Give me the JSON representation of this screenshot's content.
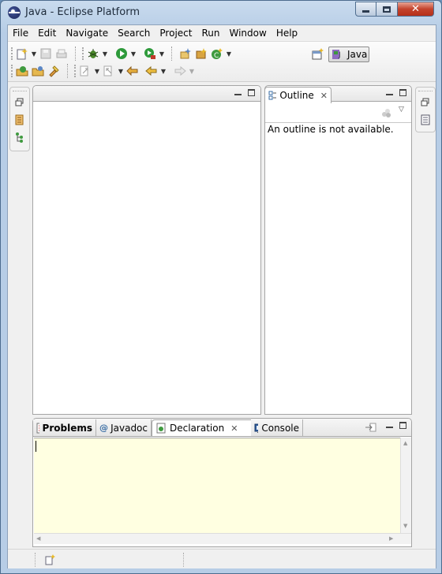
{
  "window": {
    "title": "Java - Eclipse Platform",
    "controls": {
      "minimize": "minimize",
      "maximize": "maximize",
      "close": "close"
    }
  },
  "menubar": {
    "items": [
      {
        "label": "File"
      },
      {
        "label": "Edit"
      },
      {
        "label": "Navigate"
      },
      {
        "label": "Search"
      },
      {
        "label": "Project"
      },
      {
        "label": "Run"
      },
      {
        "label": "Window"
      },
      {
        "label": "Help"
      }
    ]
  },
  "perspectives": {
    "open_perspective": "open-perspective-icon",
    "active": {
      "label": "Java"
    }
  },
  "outline_view": {
    "tab_label": "Outline",
    "message": "An outline is not available."
  },
  "bottom_panel": {
    "tabs": [
      {
        "label": "Problems",
        "icon": "problems-icon"
      },
      {
        "label": "Javadoc",
        "icon": "at-sign-icon"
      },
      {
        "label": "Declaration",
        "icon": "declaration-icon"
      },
      {
        "label": "Console",
        "icon": "console-icon"
      }
    ],
    "active_tab": "Declaration"
  },
  "colors": {
    "frame": "#b7cde6",
    "console_bg": "#ffffe1",
    "close_button": "#c4432c"
  }
}
